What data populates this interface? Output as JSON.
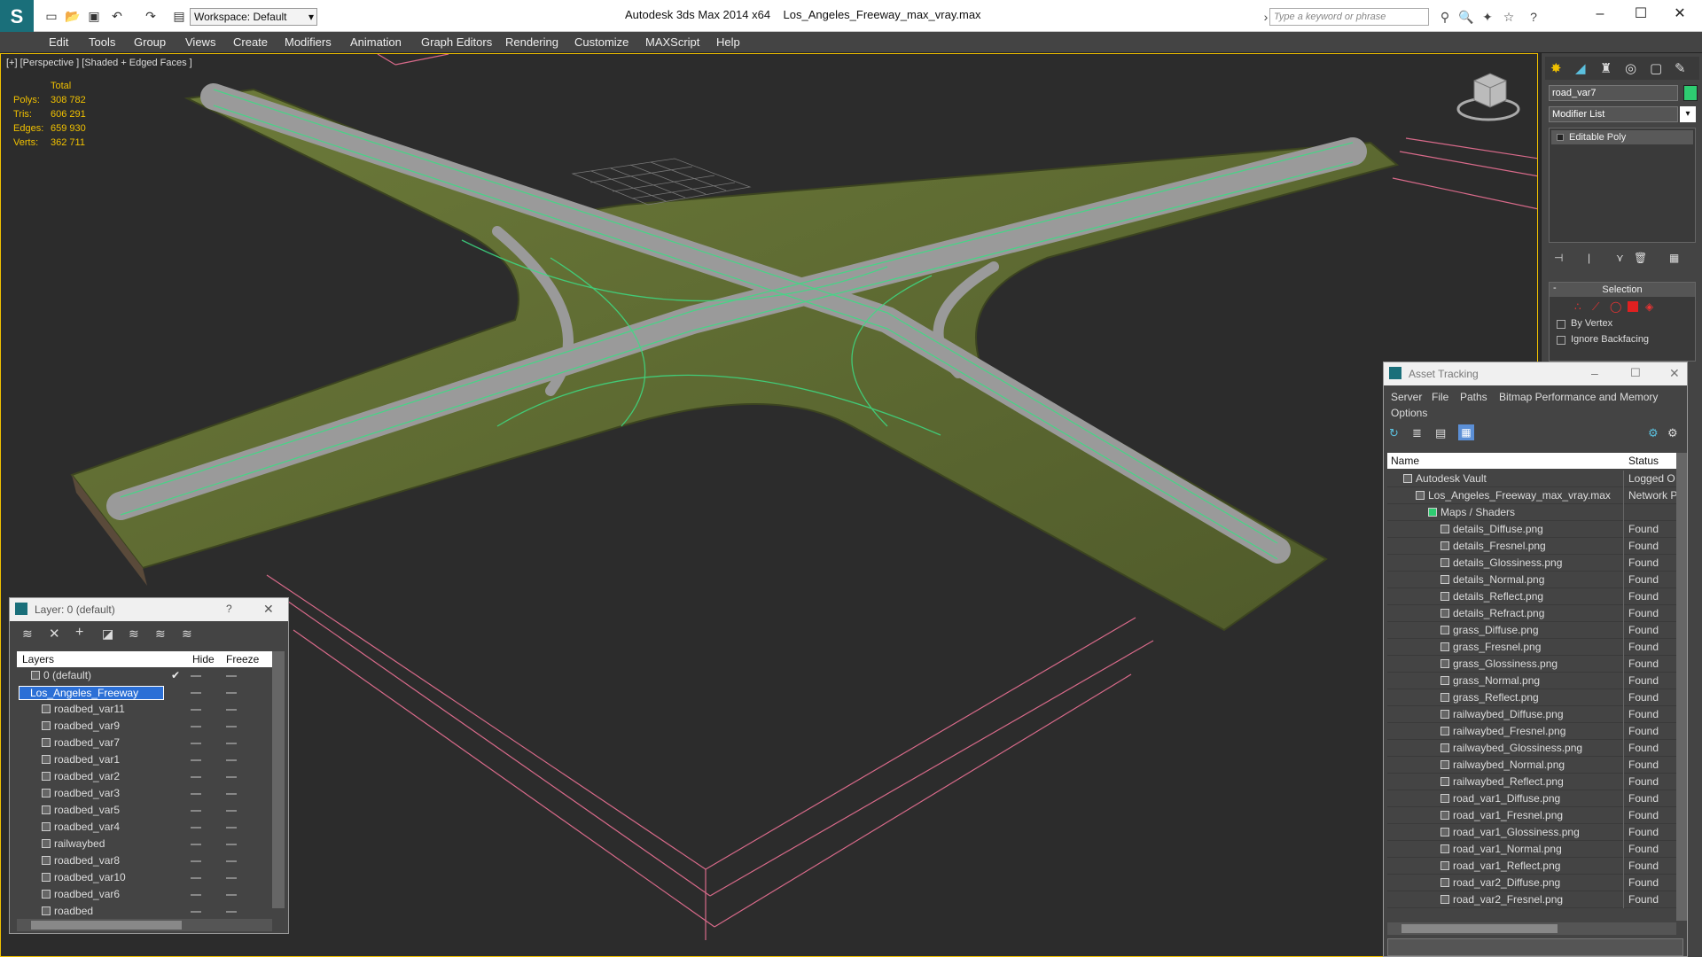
{
  "titlebar": {
    "app_title": "Autodesk 3ds Max  2014 x64",
    "file_title": "Los_Angeles_Freeway_max_vray.max",
    "workspace": "Workspace: Default",
    "search_placeholder": "Type a keyword or phrase"
  },
  "menu": [
    "Edit",
    "Tools",
    "Group",
    "Views",
    "Create",
    "Modifiers",
    "Animation",
    "Graph Editors",
    "Rendering",
    "Customize",
    "MAXScript",
    "Help"
  ],
  "viewport": {
    "label": "[+] [Perspective ] [Shaded + Edged Faces ]",
    "stats_header": "Total",
    "stats": [
      {
        "label": "Polys:",
        "value": "308 782"
      },
      {
        "label": "Tris:",
        "value": "606 291"
      },
      {
        "label": "Edges:",
        "value": "659 930"
      },
      {
        "label": "Verts:",
        "value": "362 711"
      }
    ]
  },
  "command_panel": {
    "object_name": "road_var7",
    "modifier_list": "Modifier List",
    "stack_item": "Editable Poly",
    "selection_title": "Selection",
    "by_vertex": "By Vertex",
    "ignore_backfacing": "Ignore Backfacing",
    "accent_color": "#2ecc71"
  },
  "layers": {
    "title": "Layer: 0 (default)",
    "help": "?",
    "col_layers": "Layers",
    "col_hide": "Hide",
    "col_freeze": "Freeze",
    "rows": [
      {
        "name": "0 (default)",
        "level": 0,
        "check": "✔"
      },
      {
        "name": "Los_Angeles_Freeway",
        "level": 0,
        "selected": true
      },
      {
        "name": "roadbed_var11",
        "level": 1
      },
      {
        "name": "roadbed_var9",
        "level": 1
      },
      {
        "name": "roadbed_var7",
        "level": 1
      },
      {
        "name": "roadbed_var1",
        "level": 1
      },
      {
        "name": "roadbed_var2",
        "level": 1
      },
      {
        "name": "roadbed_var3",
        "level": 1
      },
      {
        "name": "roadbed_var5",
        "level": 1
      },
      {
        "name": "roadbed_var4",
        "level": 1
      },
      {
        "name": "railwaybed",
        "level": 1
      },
      {
        "name": "roadbed_var8",
        "level": 1
      },
      {
        "name": "roadbed_var10",
        "level": 1
      },
      {
        "name": "roadbed_var6",
        "level": 1
      },
      {
        "name": "roadbed",
        "level": 1
      }
    ]
  },
  "asset_tracking": {
    "title": "Asset Tracking",
    "menus": [
      "Server",
      "File",
      "Paths",
      "Bitmap Performance and Memory",
      "Options"
    ],
    "col_name": "Name",
    "col_status": "Status",
    "rows": [
      {
        "name": "Autodesk Vault",
        "level": 0,
        "status": "Logged O"
      },
      {
        "name": "Los_Angeles_Freeway_max_vray.max",
        "level": 1,
        "status": "Network P"
      },
      {
        "name": "Maps / Shaders",
        "level": 2,
        "status": ""
      },
      {
        "name": "details_Diffuse.png",
        "level": 3,
        "status": "Found"
      },
      {
        "name": "details_Fresnel.png",
        "level": 3,
        "status": "Found"
      },
      {
        "name": "details_Glossiness.png",
        "level": 3,
        "status": "Found"
      },
      {
        "name": "details_Normal.png",
        "level": 3,
        "status": "Found"
      },
      {
        "name": "details_Reflect.png",
        "level": 3,
        "status": "Found"
      },
      {
        "name": "details_Refract.png",
        "level": 3,
        "status": "Found"
      },
      {
        "name": "grass_Diffuse.png",
        "level": 3,
        "status": "Found"
      },
      {
        "name": "grass_Fresnel.png",
        "level": 3,
        "status": "Found"
      },
      {
        "name": "grass_Glossiness.png",
        "level": 3,
        "status": "Found"
      },
      {
        "name": "grass_Normal.png",
        "level": 3,
        "status": "Found"
      },
      {
        "name": "grass_Reflect.png",
        "level": 3,
        "status": "Found"
      },
      {
        "name": "railwaybed_Diffuse.png",
        "level": 3,
        "status": "Found"
      },
      {
        "name": "railwaybed_Fresnel.png",
        "level": 3,
        "status": "Found"
      },
      {
        "name": "railwaybed_Glossiness.png",
        "level": 3,
        "status": "Found"
      },
      {
        "name": "railwaybed_Normal.png",
        "level": 3,
        "status": "Found"
      },
      {
        "name": "railwaybed_Reflect.png",
        "level": 3,
        "status": "Found"
      },
      {
        "name": "road_var1_Diffuse.png",
        "level": 3,
        "status": "Found"
      },
      {
        "name": "road_var1_Fresnel.png",
        "level": 3,
        "status": "Found"
      },
      {
        "name": "road_var1_Glossiness.png",
        "level": 3,
        "status": "Found"
      },
      {
        "name": "road_var1_Normal.png",
        "level": 3,
        "status": "Found"
      },
      {
        "name": "road_var1_Reflect.png",
        "level": 3,
        "status": "Found"
      },
      {
        "name": "road_var2_Diffuse.png",
        "level": 3,
        "status": "Found"
      },
      {
        "name": "road_var2_Fresnel.png",
        "level": 3,
        "status": "Found"
      }
    ]
  }
}
